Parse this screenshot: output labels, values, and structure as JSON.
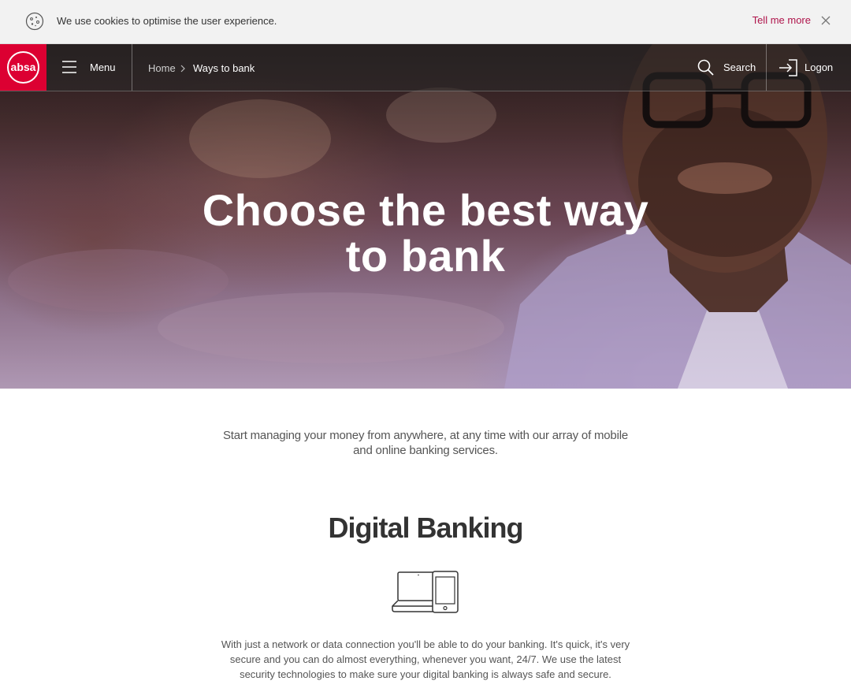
{
  "cookie_bar": {
    "icon": "cookie-icon",
    "message": "We use cookies to optimise the user experience.",
    "link_label": "Tell me more",
    "close_icon": "close-icon",
    "link_color": "#af144b"
  },
  "header": {
    "logo_text": "absa",
    "logo_color": "#dc0032",
    "menu_label": "Menu",
    "breadcrumb": [
      "Home",
      "Ways to bank"
    ],
    "search_label": "Search",
    "logon_label": "Logon"
  },
  "hero": {
    "title": "Choose the best way to bank"
  },
  "main": {
    "intro": "Start managing your money from anywhere, at any time with our array of mobile and online banking services.",
    "section_title": "Digital Banking",
    "section_icon": "laptop-phone-icon",
    "section_body": "With just a network or data connection you'll be able to do your banking. It's quick, it's very secure and you can do almost everything, whenever you want, 24/7. We use the latest security technologies to make sure your digital banking is always safe and secure."
  }
}
